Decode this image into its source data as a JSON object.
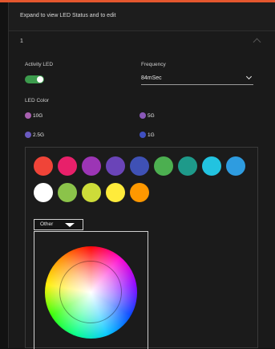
{
  "header": {
    "title": "Expand to view LED Status and to edit"
  },
  "section": {
    "number": "1"
  },
  "activity": {
    "label": "Activity LED",
    "enabled": true
  },
  "frequency": {
    "label": "Frequency",
    "value": "84mSec"
  },
  "led_color": {
    "label": "LED Color",
    "items": [
      {
        "name": "10G",
        "color": "#a860b0"
      },
      {
        "name": "5G",
        "color": "#8a58b8"
      },
      {
        "name": "2.5G",
        "color": "#6a5ac0"
      },
      {
        "name": "1G",
        "color": "#3f4fc0"
      }
    ]
  },
  "palette": {
    "row1": [
      "#f04438",
      "#e8206a",
      "#9c35b5",
      "#6a44b8",
      "#3f51b5",
      "#4caf50",
      "#1e9a8a",
      "#22c3e0",
      "#2e9ce0"
    ],
    "row2": [
      "#ffffff",
      "#8bc34a",
      "#cddc39",
      "#ffeb3b",
      "#ff9800"
    ]
  },
  "picker_mode": {
    "label": "Other"
  }
}
